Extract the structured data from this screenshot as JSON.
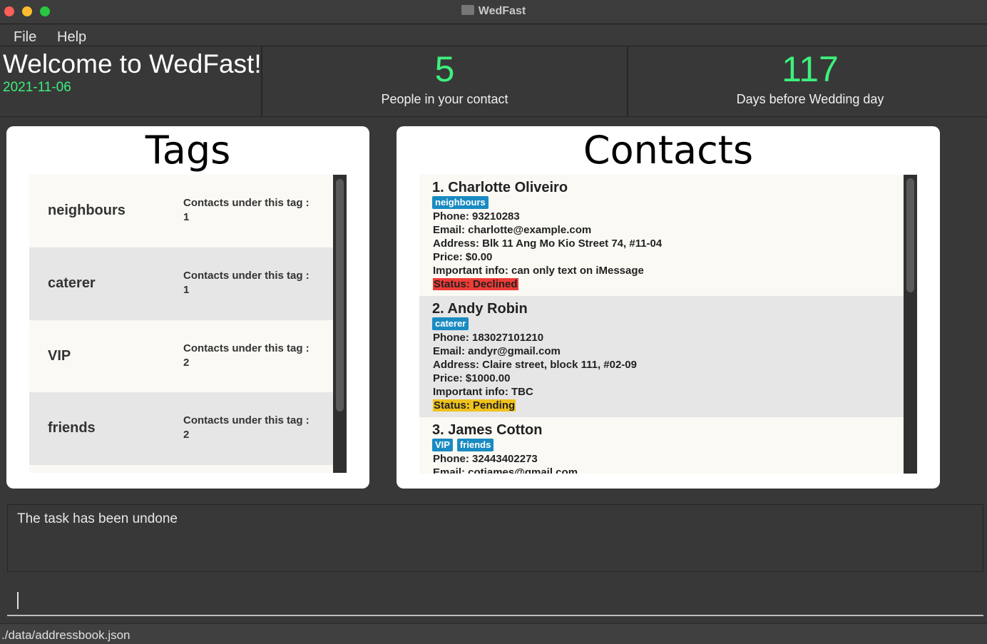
{
  "window": {
    "title": "WedFast"
  },
  "menu": {
    "file": "File",
    "help": "Help"
  },
  "header": {
    "welcome": "Welcome to WedFast!",
    "date": "2021-11-06",
    "people_count": "5",
    "people_label": "People in your contact",
    "days_count": "117",
    "days_label": "Days before Wedding day"
  },
  "tags_panel": {
    "title": "Tags",
    "count_label": "Contacts under this tag :",
    "items": [
      {
        "name": "neighbours",
        "count": "1"
      },
      {
        "name": "caterer",
        "count": "1"
      },
      {
        "name": "VIP",
        "count": "2"
      },
      {
        "name": "friends",
        "count": "2"
      }
    ]
  },
  "contacts_panel": {
    "title": "Contacts",
    "items": [
      {
        "name": "1.  Charlotte Oliveiro",
        "tags": [
          "neighbours"
        ],
        "phone": "Phone: 93210283",
        "email": "Email: charlotte@example.com",
        "address": "Address: Blk 11 Ang Mo Kio Street 74, #11-04",
        "price": "Price: $0.00",
        "info": "Important info: can only text on iMessage",
        "status": "Status: Declined"
      },
      {
        "name": "2.  Andy Robin",
        "tags": [
          "caterer"
        ],
        "phone": "Phone: 183027101210",
        "email": "Email: andyr@gmail.com",
        "address": "Address: Claire street, block 111, #02-09",
        "price": "Price: $1000.00",
        "info": "Important info: TBC",
        "status": "Status: Pending"
      },
      {
        "name": "3.  James Cotton",
        "tags": [
          "VIP",
          "friends"
        ],
        "phone": "Phone: 32443402273",
        "email": "Email: cotjames@gmail.com"
      }
    ]
  },
  "result": {
    "text": "The task has been undone"
  },
  "command": {
    "value": "",
    "placeholder": ""
  },
  "statusbar": {
    "path": "./data/addressbook.json"
  },
  "colors": {
    "accent_green": "#3df07c",
    "tag_chip": "#1a8bc2",
    "status_declined": "#ef3b36",
    "status_pending": "#efc21c"
  }
}
